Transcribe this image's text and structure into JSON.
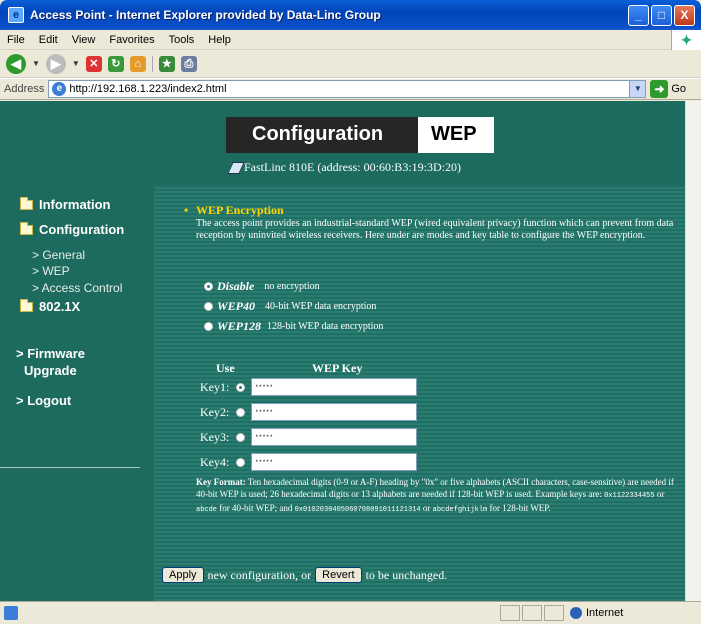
{
  "window": {
    "title": "Access Point - Internet Explorer provided by Data-Linc Group",
    "controls": [
      "_",
      "□",
      "X"
    ]
  },
  "menu": [
    "File",
    "Edit",
    "View",
    "Favorites",
    "Tools",
    "Help"
  ],
  "toolbar": {
    "icons": [
      "back-icon",
      "forward-icon",
      "stop-icon",
      "refresh-icon",
      "home-icon",
      "favorites-icon",
      "print-icon"
    ]
  },
  "address": {
    "label": "Address",
    "url": "http://192.168.1.223/index2.html",
    "go_label": "Go"
  },
  "header": {
    "section": "Configuration",
    "page": "WEP",
    "device": "FastLinc 810E (address: 00:60:B3:19:3D:20)"
  },
  "sidebar": {
    "information": "Information",
    "configuration": "Configuration",
    "general": "> General",
    "wep": "> WEP",
    "access_control": "> Access Control",
    "dot1x": "802.1X",
    "firmware_1": "> Firmware",
    "firmware_2": "Upgrade",
    "logout": "> Logout"
  },
  "wep": {
    "title": "WEP Encryption",
    "intro": "The access point provides an industrial-standard WEP (wired equivalent privacy) function which can prevent from data reception by uninvited wireless receivers. Here under are modes and key table to configure the WEP encryption.",
    "modes": [
      {
        "name": "Disable",
        "desc": "no encryption",
        "selected": true
      },
      {
        "name": "WEP40",
        "desc": "40-bit WEP data encryption",
        "selected": false
      },
      {
        "name": "WEP128",
        "desc": "128-bit WEP data encryption",
        "selected": false
      }
    ],
    "col_use": "Use",
    "col_key": "WEP Key",
    "keys": [
      {
        "label": "Key1:",
        "value": "*****",
        "selected": true
      },
      {
        "label": "Key2:",
        "value": "*****",
        "selected": false
      },
      {
        "label": "Key3:",
        "value": "*****",
        "selected": false
      },
      {
        "label": "Key4:",
        "value": "*****",
        "selected": false
      }
    ],
    "format_title": "Key Format:",
    "format_text_1": " Ten hexadecimal digits (0-9 or A-F) heading by \"0x\" or five alphabets (ASCII characters, case-sensitive) are needed if 40-bit WEP is used; 26 hexadecimal digits or 13 alphabets are needed if 128-bit WEP is used. Example keys are: ",
    "example_40_hex": "0x1122334455",
    "or_1": " or ",
    "example_40_alpha": "abcde",
    "format_text_2": " for 40-bit WEP; and ",
    "example_128_hex": "0x0102030405060708091011121314",
    "or_2": " or ",
    "example_128_alpha": "abcdefghijklm",
    "format_text_3": " for 128-bit WEP."
  },
  "actions": {
    "apply": "Apply",
    "middle": "new configuration, or",
    "revert": "Revert",
    "end": "to be unchanged."
  },
  "status": {
    "zone": "Internet"
  },
  "colors": {
    "page_bg": "#1d6a5f",
    "title_yellow": "#ffd800"
  }
}
